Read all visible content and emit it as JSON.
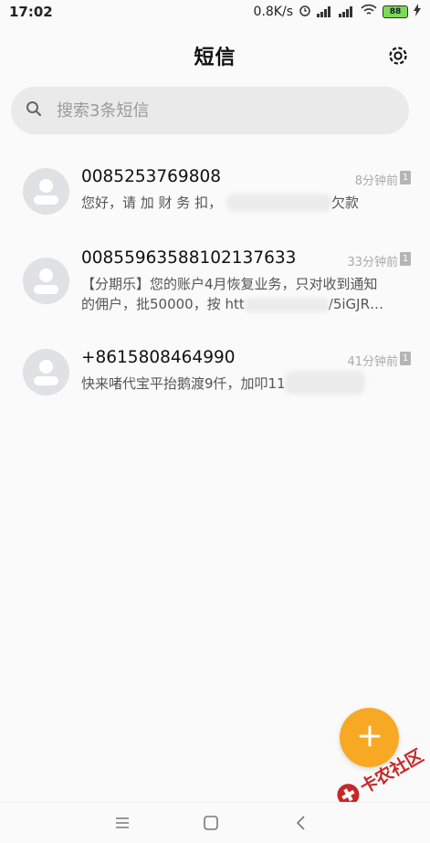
{
  "status_bar": {
    "time": "17:02",
    "speed": "0.8K/s",
    "battery": "88"
  },
  "header": {
    "title": "短信"
  },
  "search": {
    "placeholder": "搜索3条短信"
  },
  "messages": [
    {
      "sender": "0085253769808",
      "time": "8分钟前",
      "sim": "1",
      "preview": "您好，请 加 财 务 扣，",
      "preview_tail": "欠款"
    },
    {
      "sender": "0085596358810213763​3",
      "time": "33分钟前",
      "sim": "1",
      "preview_line1": "【分期乐】您的账户4月恢复业务，只对收到通知",
      "preview_line2": "的佣户，批50000，按 htt",
      "preview_line2_tail": "/5iGJR…"
    },
    {
      "sender": "+8615808464990",
      "time": "41分钟前",
      "sim": "1",
      "preview": "快来啫代宝平抬鹅渡9仟，加叩11"
    }
  ],
  "watermark": {
    "text": "卡农社区"
  },
  "colors": {
    "background": "#fafafa",
    "search_bg": "#eaeaea",
    "avatar_bg": "#dfe1e5",
    "fab": "#f7a924",
    "battery": "#7ed957",
    "watermark": "#c62828"
  },
  "icons": {
    "settings": "gear-icon",
    "search": "search-icon",
    "fab": "plus-icon",
    "nav_menu": "menu-icon",
    "nav_home": "square-home-icon",
    "nav_back": "back-chevron-icon"
  }
}
